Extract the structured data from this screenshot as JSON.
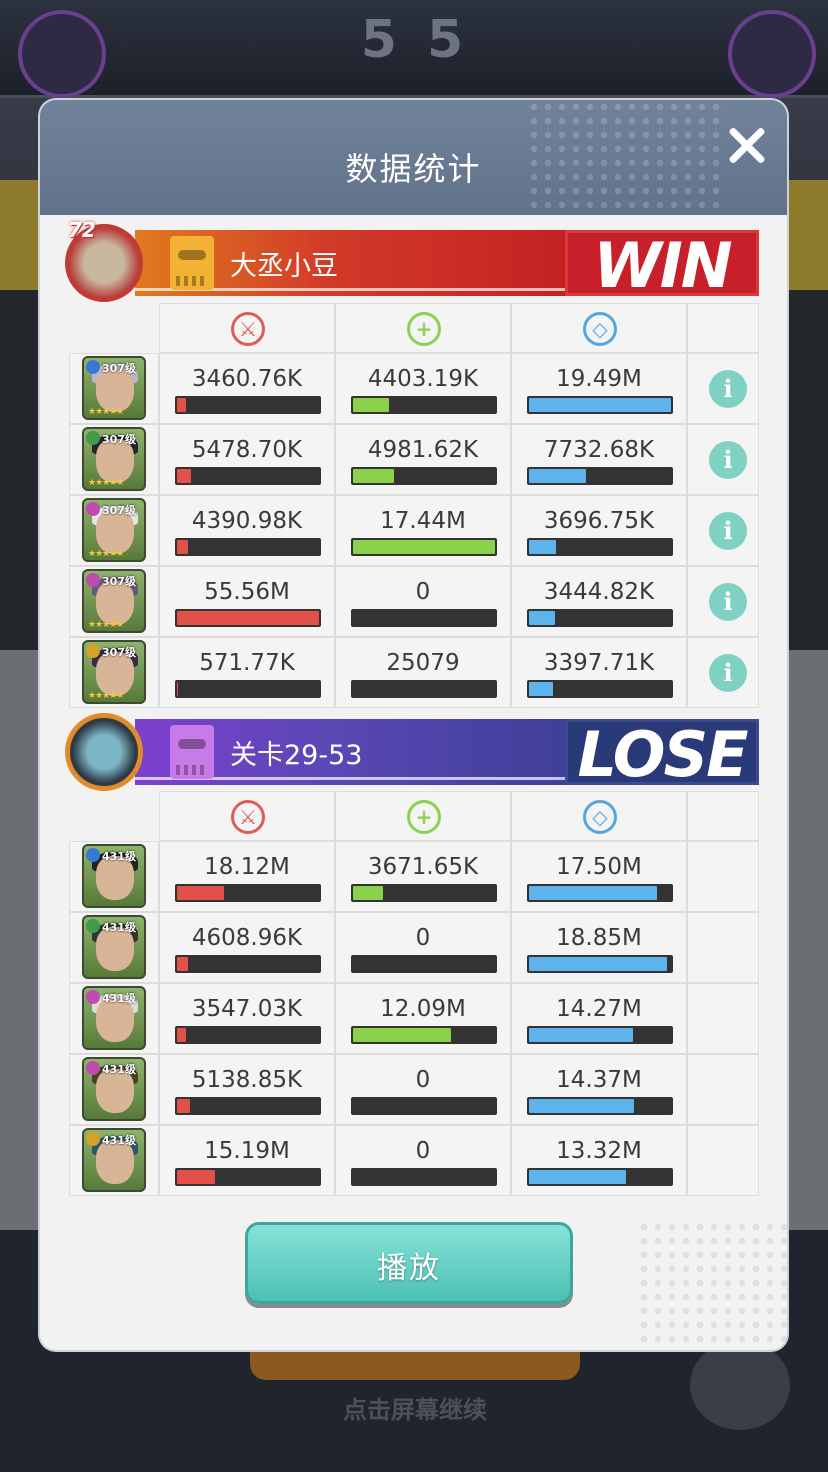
{
  "background": {
    "score": "5 5",
    "bottom_hint": "点击屏幕继续"
  },
  "dialog": {
    "title": "数据统计",
    "play_label": "播放"
  },
  "teams": [
    {
      "name": "大丞小豆",
      "result": "WIN",
      "level": "72",
      "rows": [
        {
          "hero_level": "307级",
          "damage": "3460.76K",
          "damage_pct": 0.06,
          "heal": "4403.19K",
          "heal_pct": 0.25,
          "shield": "19.49M",
          "shield_pct": 1.0
        },
        {
          "hero_level": "307级",
          "damage": "5478.70K",
          "damage_pct": 0.1,
          "heal": "4981.62K",
          "heal_pct": 0.29,
          "shield": "7732.68K",
          "shield_pct": 0.4
        },
        {
          "hero_level": "307级",
          "damage": "4390.98K",
          "damage_pct": 0.08,
          "heal": "17.44M",
          "heal_pct": 1.0,
          "shield": "3696.75K",
          "shield_pct": 0.19
        },
        {
          "hero_level": "307级",
          "damage": "55.56M",
          "damage_pct": 1.0,
          "heal": "0",
          "heal_pct": 0,
          "shield": "3444.82K",
          "shield_pct": 0.18
        },
        {
          "hero_level": "307级",
          "damage": "571.77K",
          "damage_pct": 0.01,
          "heal": "25079",
          "heal_pct": 0,
          "shield": "3397.71K",
          "shield_pct": 0.17
        }
      ]
    },
    {
      "name": "关卡29-53",
      "result": "LOSE",
      "rows": [
        {
          "hero_level": "431级",
          "damage": "18.12M",
          "damage_pct": 0.33,
          "heal": "3671.65K",
          "heal_pct": 0.21,
          "shield": "17.50M",
          "shield_pct": 0.9
        },
        {
          "hero_level": "431级",
          "damage": "4608.96K",
          "damage_pct": 0.08,
          "heal": "0",
          "heal_pct": 0,
          "shield": "18.85M",
          "shield_pct": 0.97
        },
        {
          "hero_level": "431级",
          "damage": "3547.03K",
          "damage_pct": 0.06,
          "heal": "12.09M",
          "heal_pct": 0.69,
          "shield": "14.27M",
          "shield_pct": 0.73
        },
        {
          "hero_level": "431级",
          "damage": "5138.85K",
          "damage_pct": 0.09,
          "heal": "0",
          "heal_pct": 0,
          "shield": "14.37M",
          "shield_pct": 0.74
        },
        {
          "hero_level": "431级",
          "damage": "15.19M",
          "damage_pct": 0.27,
          "heal": "0",
          "heal_pct": 0,
          "shield": "13.32M",
          "shield_pct": 0.68
        }
      ]
    }
  ],
  "column_icons": [
    "attack-icon",
    "heal-icon",
    "shield-icon"
  ],
  "colors": {
    "damage": "#e15149",
    "heal": "#8cd14a",
    "shield": "#5db4ec",
    "win": "#c8202a",
    "lose": "#2a3a78",
    "info": "#7fd1c2",
    "play": "#4ec0b4"
  }
}
